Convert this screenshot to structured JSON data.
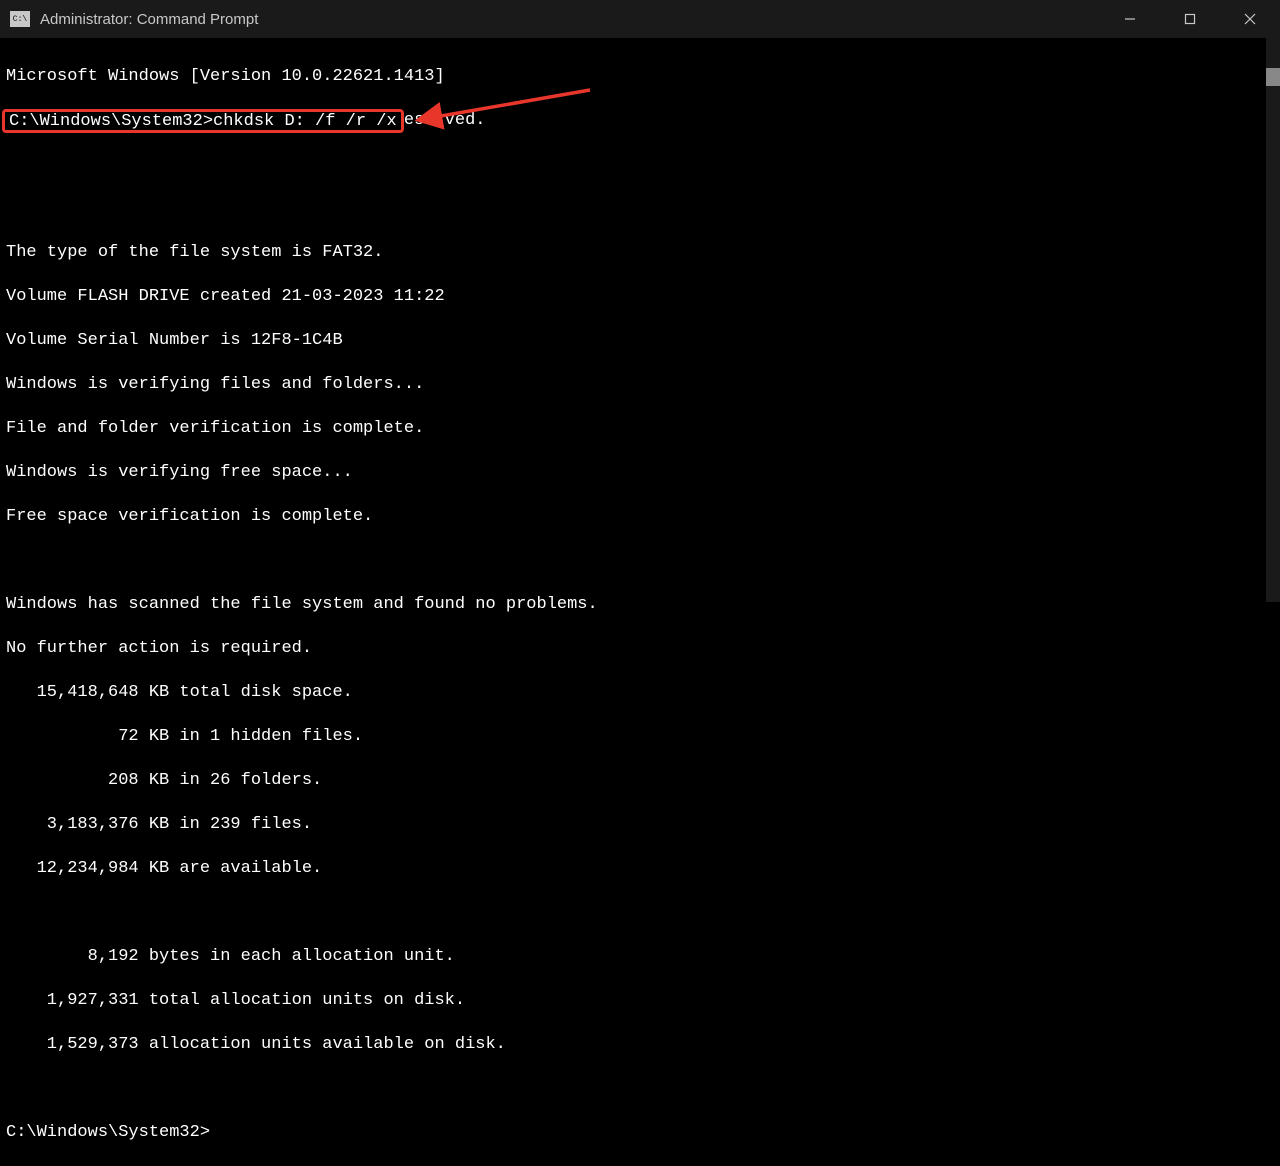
{
  "window": {
    "title": "Administrator: Command Prompt",
    "icon_label": "C:\\"
  },
  "terminal": {
    "line1": "Microsoft Windows [Version 10.0.22621.1413]",
    "line2": "(c) Microsoft Corporation. All rights reserved.",
    "blank1": "",
    "prompt_highlighted": "C:\\Windows\\System32>chkdsk D: /f /r /x",
    "out1": "The type of the file system is FAT32.",
    "out2": "Volume FLASH DRIVE created 21-03-2023 11:22",
    "out3": "Volume Serial Number is 12F8-1C4B",
    "out4": "Windows is verifying files and folders...",
    "out5": "File and folder verification is complete.",
    "out6": "Windows is verifying free space...",
    "out7": "Free space verification is complete.",
    "blank2": "",
    "out8": "Windows has scanned the file system and found no problems.",
    "out9": "No further action is required.",
    "out10": "   15,418,648 KB total disk space.",
    "out11": "           72 KB in 1 hidden files.",
    "out12": "          208 KB in 26 folders.",
    "out13": "    3,183,376 KB in 239 files.",
    "out14": "   12,234,984 KB are available.",
    "blank3": "",
    "out15": "        8,192 bytes in each allocation unit.",
    "out16": "    1,927,331 total allocation units on disk.",
    "out17": "    1,529,373 allocation units available on disk.",
    "blank4": "",
    "prompt_end": "C:\\Windows\\System32>"
  },
  "annotation": {
    "highlight_color": "#e8362b"
  }
}
